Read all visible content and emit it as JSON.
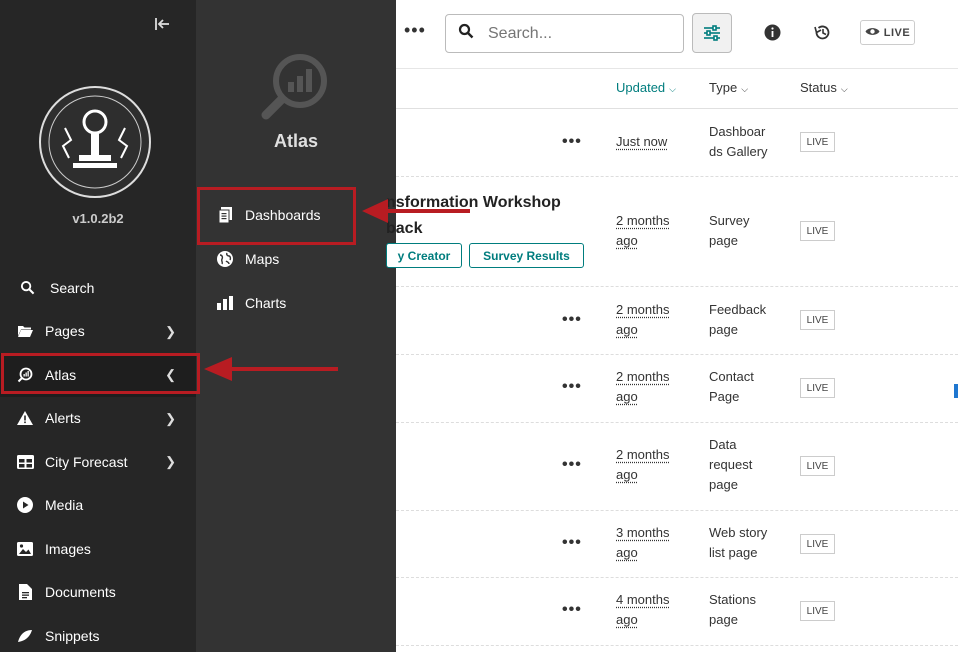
{
  "sidebar": {
    "version": "v1.0.2b2",
    "items": [
      {
        "label": "Search",
        "icon": "search-icon"
      },
      {
        "label": "Pages",
        "icon": "folder-open-icon"
      },
      {
        "label": "Atlas",
        "icon": "atlas-icon"
      },
      {
        "label": "Alerts",
        "icon": "warning-icon"
      },
      {
        "label": "City Forecast",
        "icon": "table-icon"
      },
      {
        "label": "Media",
        "icon": "play-icon"
      },
      {
        "label": "Images",
        "icon": "image-icon"
      },
      {
        "label": "Documents",
        "icon": "document-icon"
      },
      {
        "label": "Snippets",
        "icon": "snippet-icon"
      }
    ]
  },
  "submenu": {
    "title": "Atlas",
    "items": [
      {
        "label": "Dashboards",
        "icon": "dashboard-icon"
      },
      {
        "label": "Maps",
        "icon": "globe-icon"
      },
      {
        "label": "Charts",
        "icon": "bar-chart-icon"
      }
    ]
  },
  "header": {
    "search_placeholder": "Search...",
    "live_label": "LIVE"
  },
  "table": {
    "headers": {
      "updated": "Updated",
      "type": "Type",
      "status": "Status"
    },
    "rows": [
      {
        "updated": [
          "Just now"
        ],
        "type": [
          "Dashboar",
          "ds Gallery"
        ],
        "status": "LIVE"
      },
      {
        "updated": [
          "2 months",
          "ago"
        ],
        "type": [
          "Survey",
          "page"
        ],
        "status": "LIVE",
        "title_line1": "nsformation Workshop",
        "title_line2": "back",
        "tags": [
          "y Creator",
          "Survey Results"
        ]
      },
      {
        "updated": [
          "2 months",
          "ago"
        ],
        "type": [
          "Feedback",
          "page"
        ],
        "status": "LIVE"
      },
      {
        "updated": [
          "2 months",
          "ago"
        ],
        "type": [
          "Contact",
          "Page"
        ],
        "status": "LIVE"
      },
      {
        "updated": [
          "2 months",
          "ago"
        ],
        "type": [
          "Data",
          "request",
          "page"
        ],
        "status": "LIVE"
      },
      {
        "updated": [
          "3 months",
          "ago"
        ],
        "type": [
          "Web story",
          "list page"
        ],
        "status": "LIVE"
      },
      {
        "updated": [
          "4 months",
          "ago"
        ],
        "type": [
          "Stations",
          "page"
        ],
        "status": "LIVE"
      }
    ]
  },
  "colors": {
    "accent": "#007d7e",
    "highlight": "#b81c22",
    "sidebar": "#262626",
    "submenu": "#333333"
  }
}
